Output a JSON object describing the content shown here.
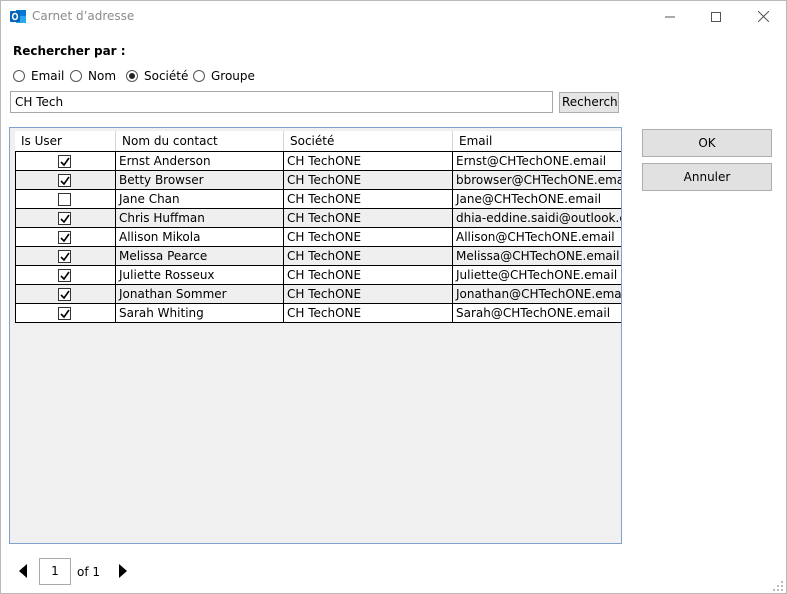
{
  "window": {
    "title": "Carnet d’adresse"
  },
  "search": {
    "label": "Rechercher par :",
    "options": [
      {
        "label": "Email",
        "selected": false
      },
      {
        "label": "Nom",
        "selected": false
      },
      {
        "label": "Société",
        "selected": true
      },
      {
        "label": "Groupe",
        "selected": false
      }
    ],
    "value": "CH Tech",
    "button_label": "Rechercher"
  },
  "table": {
    "columns": [
      "Is User",
      "Nom du contact",
      "Société",
      "Email"
    ],
    "rows": [
      {
        "is_user": true,
        "name": "Ernst Anderson",
        "company": "CH TechONE",
        "email": "Ernst@CHTechONE.email"
      },
      {
        "is_user": true,
        "name": "Betty Browser",
        "company": "CH TechONE",
        "email": "bbrowser@CHTechONE.email"
      },
      {
        "is_user": false,
        "name": "Jane Chan",
        "company": "CH TechONE",
        "email": "Jane@CHTechONE.email"
      },
      {
        "is_user": true,
        "name": "Chris Huffman",
        "company": "CH TechONE",
        "email": "dhia-eddine.saidi@outlook.cor"
      },
      {
        "is_user": true,
        "name": "Allison Mikola",
        "company": "CH TechONE",
        "email": "Allison@CHTechONE.email"
      },
      {
        "is_user": true,
        "name": "Melissa Pearce",
        "company": "CH TechONE",
        "email": "Melissa@CHTechONE.email"
      },
      {
        "is_user": true,
        "name": "Juliette Rosseux",
        "company": "CH TechONE",
        "email": "Juliette@CHTechONE.email"
      },
      {
        "is_user": true,
        "name": "Jonathan Sommer",
        "company": "CH TechONE",
        "email": "Jonathan@CHTechONE.email"
      },
      {
        "is_user": true,
        "name": "Sarah Whiting",
        "company": "CH TechONE",
        "email": "Sarah@CHTechONE.email"
      }
    ]
  },
  "actions": {
    "ok_label": "OK",
    "cancel_label": "Annuler"
  },
  "pager": {
    "current_page": "1",
    "of_text": "of 1"
  },
  "colors": {
    "accent_blue": "#0364b8",
    "grid_border": "#7da2ce",
    "grid_background": "#f0f0f0"
  }
}
